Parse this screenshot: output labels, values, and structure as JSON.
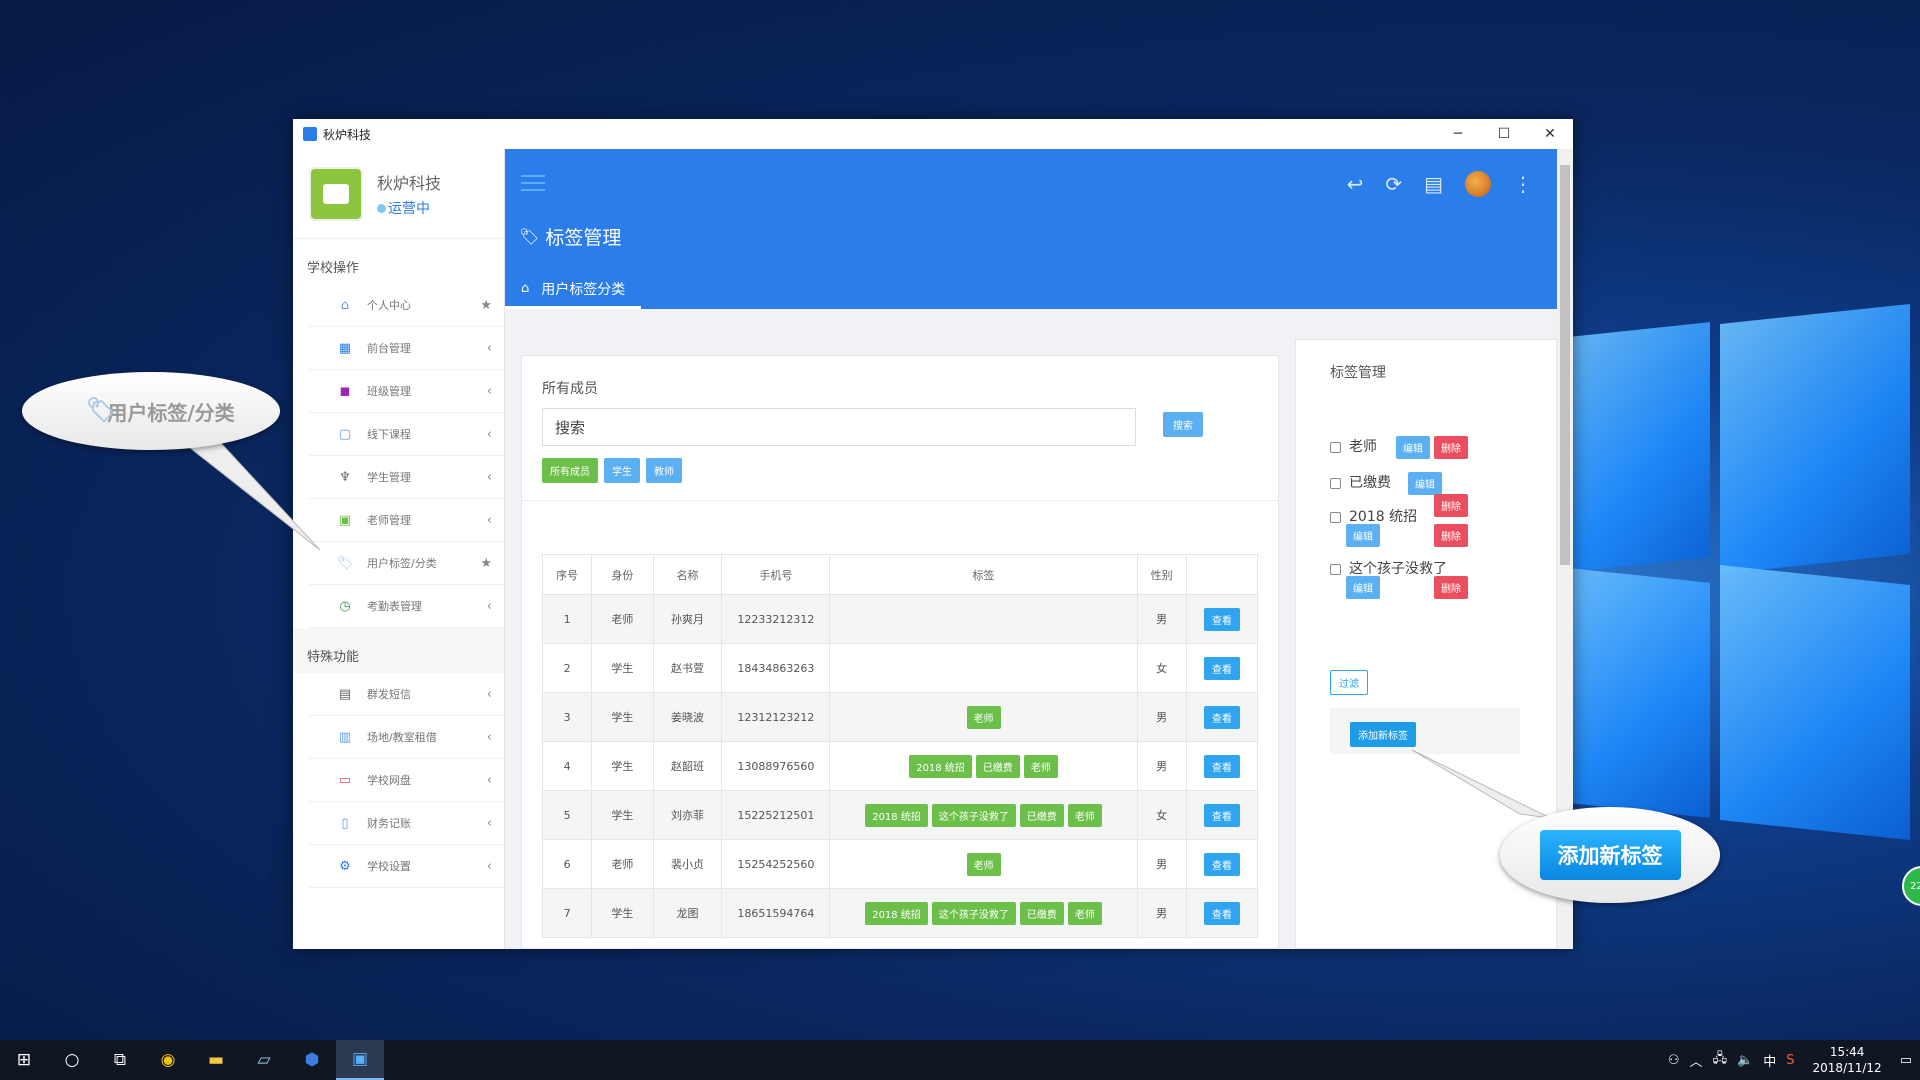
{
  "window": {
    "title": "秋炉科技"
  },
  "brand": {
    "name": "秋炉科技",
    "status": "运营中"
  },
  "sidebar": {
    "section1": "学校操作",
    "items1": [
      {
        "label": "个人中心",
        "tail": "★"
      },
      {
        "label": "前台管理",
        "tail": "‹"
      },
      {
        "label": "班级管理",
        "tail": "‹"
      },
      {
        "label": "线下课程",
        "tail": "‹"
      },
      {
        "label": "学生管理",
        "tail": "‹"
      },
      {
        "label": "老师管理",
        "tail": "‹"
      },
      {
        "label": "用户标签/分类",
        "tail": "★"
      },
      {
        "label": "考勤表管理",
        "tail": "‹"
      }
    ],
    "section2": "特殊功能",
    "items2": [
      {
        "label": "群发短信",
        "tail": "‹"
      },
      {
        "label": "场地/教室租借",
        "tail": "‹"
      },
      {
        "label": "学校网盘",
        "tail": "‹"
      },
      {
        "label": "财务记账",
        "tail": "‹"
      },
      {
        "label": "学校设置",
        "tail": "‹"
      }
    ]
  },
  "header": {
    "page_title": "标签管理",
    "tab": "用户标签分类"
  },
  "members": {
    "title": "所有成员",
    "search_placeholder": "搜索",
    "search_button": "搜索",
    "filters": [
      "所有成员",
      "学生",
      "教师"
    ],
    "columns": [
      "序号",
      "身份",
      "名称",
      "手机号",
      "标签",
      "性别",
      ""
    ],
    "view_label": "查看",
    "rows": [
      {
        "no": "1",
        "role": "老师",
        "name": "孙爽月",
        "phone": "12233212312",
        "tags": [],
        "gender": "男"
      },
      {
        "no": "2",
        "role": "学生",
        "name": "赵书萱",
        "phone": "18434863263",
        "tags": [],
        "gender": "女"
      },
      {
        "no": "3",
        "role": "学生",
        "name": "姜晓波",
        "phone": "12312123212",
        "tags": [
          "老师"
        ],
        "gender": "男"
      },
      {
        "no": "4",
        "role": "学生",
        "name": "赵韶班",
        "phone": "13088976560",
        "tags": [
          "2018 统招",
          "已缴费",
          "老师"
        ],
        "gender": "男"
      },
      {
        "no": "5",
        "role": "学生",
        "name": "刘亦菲",
        "phone": "15225212501",
        "tags": [
          "2018 统招",
          "这个孩子没救了",
          "已缴费",
          "老师"
        ],
        "gender": "女"
      },
      {
        "no": "6",
        "role": "老师",
        "name": "裴小贞",
        "phone": "15254252560",
        "tags": [
          "老师"
        ],
        "gender": "男"
      },
      {
        "no": "7",
        "role": "学生",
        "name": "龙图",
        "phone": "18651594764",
        "tags": [
          "2018 统招",
          "这个孩子没救了",
          "已缴费",
          "老师"
        ],
        "gender": "男"
      }
    ]
  },
  "tags_panel": {
    "title": "标签管理",
    "edit_label": "编辑",
    "delete_label": "删除",
    "tags": [
      "老师",
      "已缴费",
      "2018 统招",
      "这个孩子没救了"
    ],
    "filter_button": "过滤",
    "add_button": "添加新标签"
  },
  "callouts": {
    "left": "用户标签/分类",
    "right": "添加新标签"
  },
  "taskbar": {
    "time": "15:44",
    "date": "2018/11/12",
    "ime": "中",
    "notif_count": "22"
  },
  "colors": {
    "primary": "#2b7de9",
    "green": "#6cc04a",
    "red": "#e94f5e",
    "light_blue": "#5ab0f0"
  }
}
